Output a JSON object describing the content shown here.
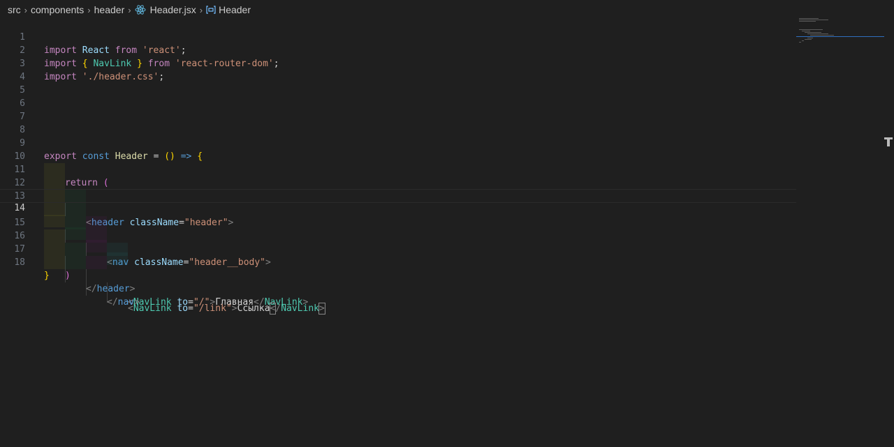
{
  "breadcrumb": {
    "items": [
      "src",
      "components",
      "header",
      "Header.jsx",
      "Header"
    ],
    "separator": "›"
  },
  "editor": {
    "current_line": 14,
    "line_numbers": [
      "1",
      "2",
      "3",
      "4",
      "5",
      "6",
      "7",
      "8",
      "9",
      "10",
      "11",
      "12",
      "13",
      "14",
      "15",
      "16",
      "17",
      "18"
    ],
    "lines": {
      "l1": {
        "import": "import",
        "react": "React",
        "from": "from",
        "src": "'react'",
        "semi": ";"
      },
      "l2": {
        "import": "import",
        "ob": "{",
        "navlink": "NavLink",
        "cb": "}",
        "from": "from",
        "src": "'react-router-dom'",
        "semi": ";"
      },
      "l3": {
        "import": "import",
        "src": "'./header.css'",
        "semi": ";"
      },
      "l9": {
        "export": "export",
        "const": "const",
        "name": "Header",
        "eq": "=",
        "parens": "()",
        "arrow": "=>",
        "ob": "{"
      },
      "l10": {
        "return": "return",
        "op": "("
      },
      "l11": {
        "lt": "<",
        "tag": "header",
        "attr": "className",
        "eq": "=",
        "val": "\"header\"",
        "gt": ">"
      },
      "l12": {
        "lt": "<",
        "tag": "nav",
        "attr": "className",
        "eq": "=",
        "val": "\"header__body\"",
        "gt": ">"
      },
      "l13": {
        "lt": "<",
        "tag": "NavLink",
        "attr": "to",
        "eq": "=",
        "val": "\"/\"",
        "gt": ">",
        "text": "Главная",
        "clt": "</",
        "ctag": "NavLink",
        "cgt": ">"
      },
      "l14": {
        "lt": "<",
        "tag": "NavLink",
        "attr": "to",
        "eq": "=",
        "val": "\"/link\"",
        "gt": ">",
        "text": "Ссылка",
        "clt": "<",
        "slash": "/",
        "ctag": "NavLink",
        "cgt": ">"
      },
      "l15": {
        "clt": "</",
        "tag": "nav",
        "cgt": ">"
      },
      "l16": {
        "clt": "</",
        "tag": "header",
        "cgt": ">"
      },
      "l17": {
        "cp": ")"
      },
      "l18": {
        "cb": "}"
      }
    }
  },
  "colors": {
    "background": "#1f1f1f",
    "keyword": "#c586c0",
    "storage": "#569cd6",
    "string": "#ce9178",
    "component": "#4ec9b0",
    "bracket_gold": "#ffd700"
  },
  "icons": {
    "breadcrumb_separator": "chevron-right-icon",
    "file": "react-icon",
    "symbol": "symbol-variable-icon"
  }
}
